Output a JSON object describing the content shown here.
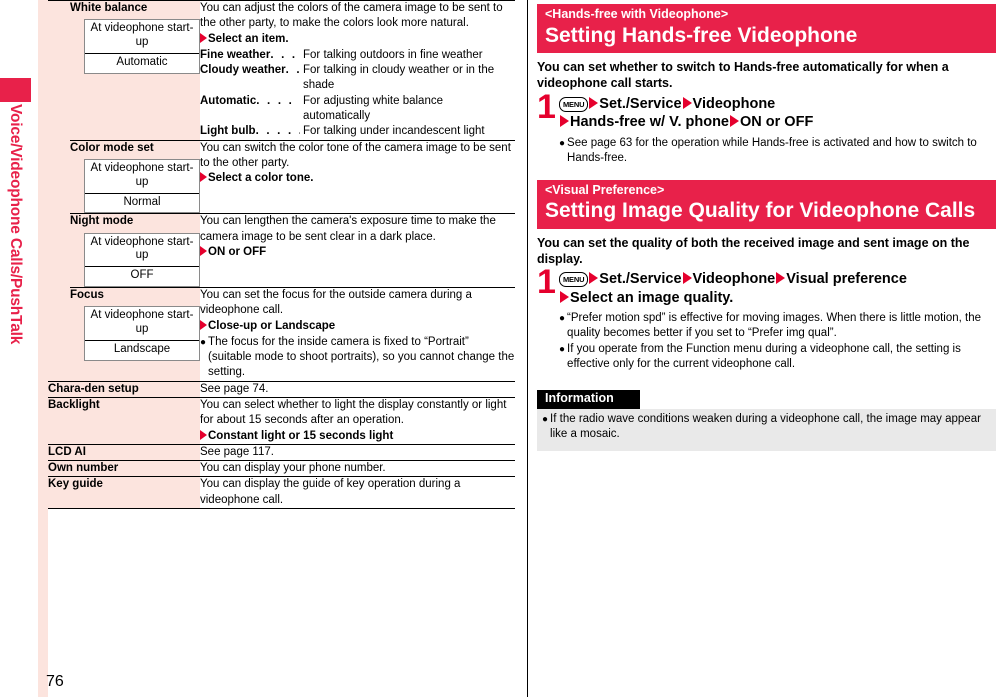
{
  "page_number": "76",
  "sidebar": {
    "label": "Voice/Videophone Calls/PushTalk",
    "tab_color": "#e8214a"
  },
  "left_column": {
    "table_rows": [
      {
        "name": "White balance",
        "indented": true,
        "default_box": {
          "top": "At videophone start-up",
          "value": "Automatic"
        },
        "desc_intro": "You can adjust the colors of the camera image to be sent to the other party, to make the colors look more natural.",
        "operation": "Select an item.",
        "definitions": [
          {
            "term": "Fine weather",
            "dots": ". . . . .",
            "desc": "For talking outdoors in fine weather",
            "cont": ""
          },
          {
            "term": "Cloudy weather",
            "dots": ". . .",
            "desc": "For talking in cloudy weather or in the",
            "cont": "shade"
          },
          {
            "term": "Automatic",
            "dots": ". . . . . . . .",
            "desc": "For adjusting white balance",
            "cont": "automatically"
          },
          {
            "term": "Light bulb",
            "dots": ". . . . . . . .",
            "desc": "For talking under incandescent light",
            "cont": ""
          }
        ],
        "notes": []
      },
      {
        "name": "Color mode set",
        "indented": true,
        "default_box": {
          "top": "At videophone start-up",
          "value": "Normal"
        },
        "desc_intro": "You can switch the color tone of the camera image to be sent to the other party.",
        "operation": "Select a color tone.",
        "definitions": [],
        "notes": []
      },
      {
        "name": "Night mode",
        "indented": true,
        "default_box": {
          "top": "At videophone start-up",
          "value": "OFF"
        },
        "desc_intro": "You can lengthen the camera's exposure time to make the camera image to be sent clear in a dark place.",
        "operation": "ON or OFF",
        "definitions": [],
        "notes": []
      },
      {
        "name": "Focus",
        "indented": true,
        "default_box": {
          "top": "At videophone start-up",
          "value": "Landscape"
        },
        "desc_intro": "You can set the focus for the outside camera during a videophone call.",
        "operation": "Close-up or Landscape",
        "definitions": [],
        "notes": [
          "The focus for the inside camera is fixed to “Portrait” (suitable mode to shoot portraits), so you cannot change the setting."
        ]
      },
      {
        "name": "Chara-den setup",
        "indented": false,
        "default_box": null,
        "desc_intro": "See page 74.",
        "operation": "",
        "definitions": [],
        "notes": []
      },
      {
        "name": "Backlight",
        "indented": false,
        "default_box": null,
        "desc_intro": "You can select whether to light the display constantly or light for about 15 seconds after an operation.",
        "operation": "Constant light or 15 seconds light",
        "definitions": [],
        "notes": []
      },
      {
        "name": "LCD AI",
        "indented": false,
        "default_box": null,
        "desc_intro": "See page 117.",
        "operation": "",
        "definitions": [],
        "notes": []
      },
      {
        "name": "Own number",
        "indented": false,
        "default_box": null,
        "desc_intro": "You can display your phone number.",
        "operation": "",
        "definitions": [],
        "notes": []
      },
      {
        "name": "Key guide",
        "indented": false,
        "default_box": null,
        "desc_intro": "You can display the guide of key operation during a videophone call.",
        "operation": "",
        "definitions": [],
        "notes": []
      }
    ]
  },
  "right_column": {
    "sections": [
      {
        "subtitle": "<Hands-free with Videophone>",
        "title": "Setting Hands-free Videophone",
        "lead": "You can set whether to switch to Hands-free automatically for when a videophone call starts.",
        "step_number": "1",
        "step_key": "MENU",
        "step_parts_line1": [
          "Set./Service",
          "Videophone"
        ],
        "step_parts_line2": [
          "Hands-free w/ V. phone",
          "ON or OFF"
        ],
        "notes": [
          "See page 63 for the operation while Hands-free is activated and how to switch to Hands-free."
        ]
      },
      {
        "subtitle": "<Visual Preference>",
        "title": "Setting Image Quality for Videophone Calls",
        "lead": "You can set the quality of both the received image and sent image on the display.",
        "step_number": "1",
        "step_key": "MENU",
        "step_parts_line1": [
          "Set./Service",
          "Videophone",
          "Visual preference"
        ],
        "step_parts_line2": [
          "Select an image quality."
        ],
        "notes": [
          "“Prefer motion spd” is effective for moving images. When there is little motion, the quality becomes better if you set to “Prefer img qual”.",
          "If you operate from the Function menu during a videophone call, the setting is effective only for the current videophone call."
        ]
      }
    ],
    "information": {
      "heading": "Information",
      "notes": [
        "If the radio wave conditions weaken during a videophone call, the image may appear like a mosaic."
      ]
    }
  }
}
